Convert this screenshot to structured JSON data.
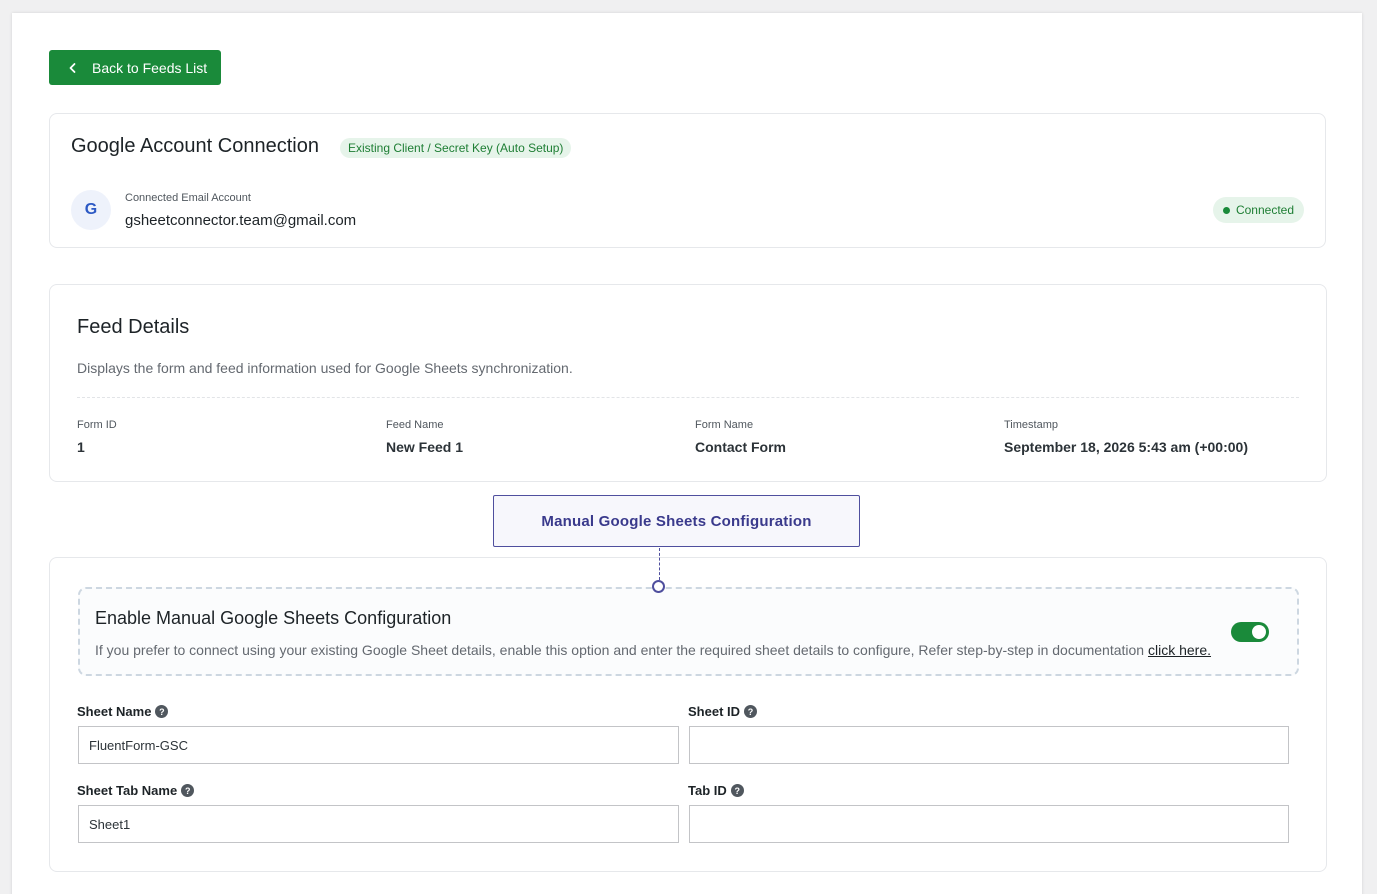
{
  "back_button": {
    "label": "Back to Feeds List"
  },
  "google_account": {
    "title": "Google Account Connection",
    "setup_badge": "Existing Client / Secret Key (Auto Setup)",
    "avatar_letter": "G",
    "email_label": "Connected Email Account",
    "email": "gsheetconnector.team@gmail.com",
    "status": "Connected"
  },
  "feed_details": {
    "title": "Feed Details",
    "description": "Displays the form and feed information used for Google Sheets synchronization.",
    "fields": [
      {
        "label": "Form ID",
        "value": "1"
      },
      {
        "label": "Feed Name",
        "value": "New Feed 1"
      },
      {
        "label": "Form Name",
        "value": "Contact Form"
      },
      {
        "label": "Timestamp",
        "value": "September 18, 2026 5:43 am (+00:00)"
      }
    ]
  },
  "manual_config": {
    "tab_label": "Manual Google Sheets Configuration",
    "enable_title": "Enable Manual Google Sheets Configuration",
    "enable_description": "If you prefer to connect using your existing Google Sheet details, enable this option and enter the required sheet details to configure, Refer step-by-step in documentation",
    "enable_link": "click here.",
    "enabled": true,
    "sheet_name": {
      "label": "Sheet Name",
      "value": "FluentForm-GSC"
    },
    "sheet_id": {
      "label": "Sheet ID",
      "value": ""
    },
    "sheet_tab_name": {
      "label": "Sheet Tab Name",
      "value": "Sheet1"
    },
    "tab_id": {
      "label": "Tab ID",
      "value": ""
    },
    "help_glyph": "?"
  },
  "colors": {
    "primary_green": "#1a8a3a",
    "accent_indigo": "#3a3a8c"
  },
  "icons": {
    "back": "chevron-left-icon",
    "help": "question-circle-icon",
    "status": "status-dot-icon"
  }
}
